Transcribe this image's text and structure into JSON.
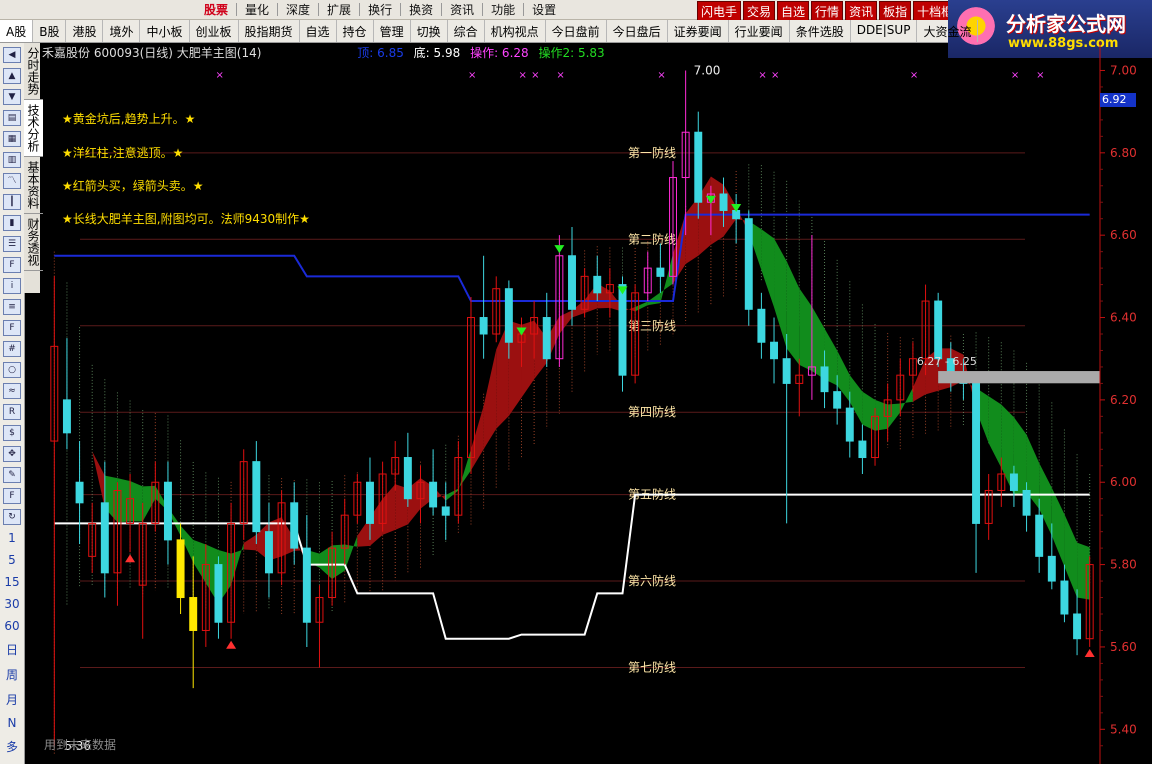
{
  "menu": {
    "items": [
      "股票",
      "量化",
      "深度",
      "扩展",
      "换行",
      "换资",
      "资讯",
      "功能",
      "设置"
    ],
    "selected": 0,
    "quick_buttons": [
      "闪电手",
      "交易",
      "自选",
      "行情",
      "资讯",
      "板指",
      "十档框"
    ]
  },
  "brand": {
    "name": "分析家公式网",
    "url": "www.88gs.com"
  },
  "tabs": [
    "A股",
    "B股",
    "港股",
    "境外",
    "中小板",
    "创业板",
    "股指期货",
    "自选",
    "持仓",
    "管理",
    "切换",
    "综合",
    "机构视点",
    "今日盘前",
    "今日盘后",
    "证券要闻",
    "行业要闻",
    "条件选股",
    "DDE|SUP",
    "大资金流"
  ],
  "vertical_tabs": [
    "分时走势",
    "技术分析",
    "基本资料",
    "财务透视"
  ],
  "left_periods": [
    "1",
    "5",
    "15",
    "30",
    "60",
    "日",
    "周",
    "月",
    "N",
    "多"
  ],
  "header": {
    "stock": "禾嘉股份 600093(日线) 大肥羊主图(14)",
    "top_label": "顶: 6.85",
    "bottom_label": "底: 5.98",
    "op1_label": "操作: 6.28",
    "op2_label": "操作2: 5.83"
  },
  "notes": [
    "★黄金坑后,趋势上升。★",
    "★洋红柱,注意逃顶。★",
    "★红箭头买，绿箭头卖。★",
    "★长线大肥羊主图,附图均可。法师9430制作★"
  ],
  "future_note": "用到未来数据",
  "defense_lines": [
    "第七防线",
    "第六防线",
    "第五防线",
    "第四防线",
    "第三防线",
    "第二防线",
    "第一防线"
  ],
  "current_price_label": "6.92",
  "range_label": "6.27 - 6.25",
  "high_label": "7.00",
  "low_label": "5.36",
  "colors": {
    "up": "#e01010",
    "down": "#3dd7e0",
    "magenta": "#ff2bd6",
    "yellow": "#ffe800",
    "ribbon_red": "#9b1010",
    "ribbon_green": "#118c1c",
    "blue_line": "#1a2ad8"
  },
  "chart_data": {
    "type": "candlestick",
    "y_axis": {
      "ticks": [
        7.0,
        6.8,
        6.6,
        6.4,
        6.2,
        6.0,
        5.8,
        5.6,
        5.4
      ],
      "ylim": [
        5.34,
        7.04
      ]
    },
    "defense_levels": [
      6.8,
      6.59,
      6.38,
      6.17,
      5.97,
      5.76,
      5.55
    ],
    "candles": [
      {
        "o": 6.1,
        "h": 6.5,
        "l": 5.36,
        "c": 6.33
      },
      {
        "o": 6.2,
        "h": 6.35,
        "l": 6.08,
        "c": 6.12
      },
      {
        "o": 6.0,
        "h": 6.1,
        "l": 5.85,
        "c": 5.95
      },
      {
        "o": 5.82,
        "h": 5.95,
        "l": 5.78,
        "c": 5.9
      },
      {
        "o": 5.95,
        "h": 6.05,
        "l": 5.72,
        "c": 5.78
      },
      {
        "o": 5.78,
        "h": 6.0,
        "l": 5.7,
        "c": 5.98
      },
      {
        "o": 5.9,
        "h": 6.02,
        "l": 5.83,
        "c": 5.96
      },
      {
        "o": 5.75,
        "h": 5.95,
        "l": 5.62,
        "c": 5.9
      },
      {
        "o": 5.9,
        "h": 6.05,
        "l": 5.88,
        "c": 6.0
      },
      {
        "o": 6.0,
        "h": 6.05,
        "l": 5.8,
        "c": 5.86
      },
      {
        "o": 5.86,
        "h": 5.9,
        "l": 5.68,
        "c": 5.72
      },
      {
        "o": 5.72,
        "h": 5.82,
        "l": 5.5,
        "c": 5.64
      },
      {
        "o": 5.64,
        "h": 5.85,
        "l": 5.6,
        "c": 5.8
      },
      {
        "o": 5.8,
        "h": 5.82,
        "l": 5.62,
        "c": 5.66
      },
      {
        "o": 5.66,
        "h": 5.95,
        "l": 5.62,
        "c": 5.9
      },
      {
        "o": 5.9,
        "h": 6.08,
        "l": 5.86,
        "c": 6.05
      },
      {
        "o": 6.05,
        "h": 6.1,
        "l": 5.85,
        "c": 5.88
      },
      {
        "o": 5.88,
        "h": 5.95,
        "l": 5.72,
        "c": 5.78
      },
      {
        "o": 5.78,
        "h": 5.98,
        "l": 5.75,
        "c": 5.95
      },
      {
        "o": 5.95,
        "h": 6.0,
        "l": 5.8,
        "c": 5.84
      },
      {
        "o": 5.84,
        "h": 5.92,
        "l": 5.6,
        "c": 5.66
      },
      {
        "o": 5.66,
        "h": 5.75,
        "l": 5.55,
        "c": 5.72
      },
      {
        "o": 5.72,
        "h": 5.88,
        "l": 5.7,
        "c": 5.84
      },
      {
        "o": 5.84,
        "h": 5.96,
        "l": 5.8,
        "c": 5.92
      },
      {
        "o": 5.92,
        "h": 6.02,
        "l": 5.9,
        "c": 6.0
      },
      {
        "o": 6.0,
        "h": 6.06,
        "l": 5.86,
        "c": 5.9
      },
      {
        "o": 5.9,
        "h": 6.05,
        "l": 5.88,
        "c": 6.02
      },
      {
        "o": 6.02,
        "h": 6.1,
        "l": 5.98,
        "c": 6.06
      },
      {
        "o": 6.06,
        "h": 6.12,
        "l": 5.94,
        "c": 5.96
      },
      {
        "o": 5.96,
        "h": 6.04,
        "l": 5.9,
        "c": 6.0
      },
      {
        "o": 6.0,
        "h": 6.08,
        "l": 5.92,
        "c": 5.94
      },
      {
        "o": 5.94,
        "h": 6.0,
        "l": 5.86,
        "c": 5.92
      },
      {
        "o": 5.92,
        "h": 6.1,
        "l": 5.9,
        "c": 6.06
      },
      {
        "o": 6.06,
        "h": 6.45,
        "l": 6.02,
        "c": 6.4
      },
      {
        "o": 6.4,
        "h": 6.55,
        "l": 6.3,
        "c": 6.36
      },
      {
        "o": 6.36,
        "h": 6.5,
        "l": 6.34,
        "c": 6.47
      },
      {
        "o": 6.47,
        "h": 6.49,
        "l": 6.3,
        "c": 6.34
      },
      {
        "o": 6.34,
        "h": 6.4,
        "l": 6.28,
        "c": 6.36
      },
      {
        "o": 6.36,
        "h": 6.44,
        "l": 6.3,
        "c": 6.4
      },
      {
        "o": 6.4,
        "h": 6.46,
        "l": 6.28,
        "c": 6.3
      },
      {
        "o": 6.3,
        "h": 6.6,
        "l": 6.28,
        "c": 6.55
      },
      {
        "o": 6.55,
        "h": 6.62,
        "l": 6.38,
        "c": 6.42
      },
      {
        "o": 6.42,
        "h": 6.52,
        "l": 6.4,
        "c": 6.5
      },
      {
        "o": 6.5,
        "h": 6.55,
        "l": 6.44,
        "c": 6.46
      },
      {
        "o": 6.46,
        "h": 6.52,
        "l": 6.4,
        "c": 6.48
      },
      {
        "o": 6.48,
        "h": 6.5,
        "l": 6.22,
        "c": 6.26
      },
      {
        "o": 6.26,
        "h": 6.48,
        "l": 6.24,
        "c": 6.46
      },
      {
        "o": 6.46,
        "h": 6.56,
        "l": 6.44,
        "c": 6.52
      },
      {
        "o": 6.52,
        "h": 6.58,
        "l": 6.46,
        "c": 6.5
      },
      {
        "o": 6.5,
        "h": 6.78,
        "l": 6.48,
        "c": 6.74
      },
      {
        "o": 6.74,
        "h": 7.0,
        "l": 6.6,
        "c": 6.85
      },
      {
        "o": 6.85,
        "h": 6.9,
        "l": 6.64,
        "c": 6.68
      },
      {
        "o": 6.68,
        "h": 6.72,
        "l": 6.6,
        "c": 6.7
      },
      {
        "o": 6.7,
        "h": 6.74,
        "l": 6.62,
        "c": 6.66
      },
      {
        "o": 6.66,
        "h": 6.7,
        "l": 6.58,
        "c": 6.64
      },
      {
        "o": 6.64,
        "h": 6.66,
        "l": 6.38,
        "c": 6.42
      },
      {
        "o": 6.42,
        "h": 6.46,
        "l": 6.3,
        "c": 6.34
      },
      {
        "o": 6.34,
        "h": 6.4,
        "l": 6.24,
        "c": 6.3
      },
      {
        "o": 6.3,
        "h": 6.36,
        "l": 5.9,
        "c": 6.24
      },
      {
        "o": 6.24,
        "h": 6.3,
        "l": 6.16,
        "c": 6.26
      },
      {
        "o": 6.26,
        "h": 6.6,
        "l": 6.2,
        "c": 6.28
      },
      {
        "o": 6.28,
        "h": 6.32,
        "l": 6.18,
        "c": 6.22
      },
      {
        "o": 6.22,
        "h": 6.26,
        "l": 6.14,
        "c": 6.18
      },
      {
        "o": 6.18,
        "h": 6.22,
        "l": 6.06,
        "c": 6.1
      },
      {
        "o": 6.1,
        "h": 6.14,
        "l": 6.02,
        "c": 6.06
      },
      {
        "o": 6.06,
        "h": 6.18,
        "l": 6.04,
        "c": 6.16
      },
      {
        "o": 6.16,
        "h": 6.24,
        "l": 6.1,
        "c": 6.2
      },
      {
        "o": 6.2,
        "h": 6.3,
        "l": 6.16,
        "c": 6.26
      },
      {
        "o": 6.26,
        "h": 6.34,
        "l": 6.22,
        "c": 6.3
      },
      {
        "o": 6.3,
        "h": 6.48,
        "l": 6.26,
        "c": 6.44
      },
      {
        "o": 6.44,
        "h": 6.46,
        "l": 6.28,
        "c": 6.3
      },
      {
        "o": 6.3,
        "h": 6.34,
        "l": 6.22,
        "c": 6.26
      },
      {
        "o": 6.26,
        "h": 6.3,
        "l": 6.2,
        "c": 6.24
      },
      {
        "o": 6.24,
        "h": 6.26,
        "l": 5.78,
        "c": 5.9
      },
      {
        "o": 5.9,
        "h": 6.02,
        "l": 5.86,
        "c": 5.98
      },
      {
        "o": 5.98,
        "h": 6.06,
        "l": 5.94,
        "c": 6.02
      },
      {
        "o": 6.02,
        "h": 6.04,
        "l": 5.94,
        "c": 5.98
      },
      {
        "o": 5.98,
        "h": 6.0,
        "l": 5.88,
        "c": 5.92
      },
      {
        "o": 5.92,
        "h": 5.96,
        "l": 5.78,
        "c": 5.82
      },
      {
        "o": 5.82,
        "h": 5.9,
        "l": 5.74,
        "c": 5.76
      },
      {
        "o": 5.76,
        "h": 5.8,
        "l": 5.66,
        "c": 5.68
      },
      {
        "o": 5.68,
        "h": 5.74,
        "l": 5.58,
        "c": 5.62
      },
      {
        "o": 5.62,
        "h": 5.82,
        "l": 5.6,
        "c": 5.8
      }
    ]
  }
}
